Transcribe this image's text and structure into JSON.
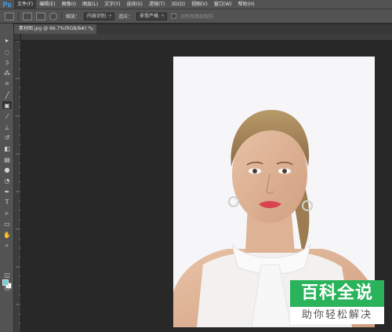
{
  "app": {
    "logo": "Ps"
  },
  "menu": {
    "items": [
      {
        "label": "文件(F)"
      },
      {
        "label": "编辑(E)"
      },
      {
        "label": "图像(I)"
      },
      {
        "label": "图层(L)"
      },
      {
        "label": "文字(Y)"
      },
      {
        "label": "选择(S)"
      },
      {
        "label": "滤镜(T)"
      },
      {
        "label": "3D(D)"
      },
      {
        "label": "视图(V)"
      },
      {
        "label": "窗口(W)"
      },
      {
        "label": "帮助(H)"
      }
    ]
  },
  "options": {
    "sample_label": "缩放：",
    "sample_value": "内容识别",
    "blend_label": "适应：",
    "blend_value": "非常严格",
    "checkbox_label": "对所有图层取样"
  },
  "document": {
    "tab_title": "素材图.jpg @ 66.7%(RGB/8#) *",
    "close_glyph": "×"
  },
  "colors": {
    "foreground": "#6fd0d6",
    "background": "#ffffff",
    "accent": "#31a8ff",
    "watermark_green": "#2bb35b"
  },
  "tools": [
    {
      "icon": "move-icon"
    },
    {
      "icon": "marquee-icon"
    },
    {
      "icon": "lasso-icon"
    },
    {
      "icon": "quick-select-icon"
    },
    {
      "icon": "crop-icon"
    },
    {
      "icon": "eyedropper-icon"
    },
    {
      "icon": "patch-icon"
    },
    {
      "icon": "brush-icon"
    },
    {
      "icon": "stamp-icon"
    },
    {
      "icon": "history-brush-icon"
    },
    {
      "icon": "eraser-icon"
    },
    {
      "icon": "gradient-icon"
    },
    {
      "icon": "blur-icon"
    },
    {
      "icon": "dodge-icon"
    },
    {
      "icon": "pen-icon"
    },
    {
      "icon": "type-icon"
    },
    {
      "icon": "path-select-icon"
    },
    {
      "icon": "shape-icon"
    },
    {
      "icon": "hand-icon"
    },
    {
      "icon": "zoom-icon"
    }
  ],
  "watermark": {
    "title": "百科全说",
    "subtitle": "助你轻松解决"
  }
}
